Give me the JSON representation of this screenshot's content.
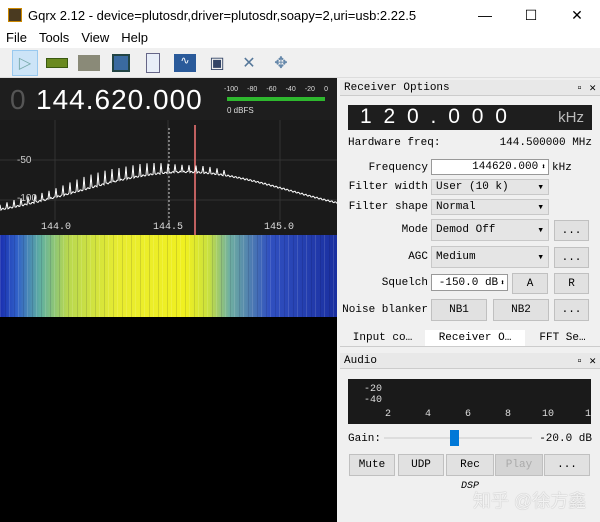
{
  "window": {
    "title": "Gqrx 2.12 - device=plutosdr,driver=plutosdr,soapy=2,uri=usb:2.22.5",
    "minimize": "—",
    "maximize": "☐",
    "close": "✕"
  },
  "menu": [
    "File",
    "Tools",
    "View",
    "Help"
  ],
  "toolbar": [
    "play-icon",
    "hardware-card-icon",
    "folder-icon",
    "save-icon",
    "document-icon",
    "waveform-icon",
    "network-icon",
    "tools-icon",
    "move-icon"
  ],
  "frequency_display": {
    "dim_digit": "0",
    "value": "144.620.000"
  },
  "signal_meter": {
    "scale": [
      "-100",
      "-80",
      "-60",
      "-40",
      "-20",
      "0"
    ],
    "label": "0 dBFS",
    "level_fraction": 1.0
  },
  "spectrum": {
    "y_labels": [
      "-50",
      "-100"
    ],
    "x_labels": [
      "144.0",
      "144.5",
      "145.0"
    ]
  },
  "receiver": {
    "title": "Receiver Options",
    "offset_display": "1 2 0 . 0 0 0",
    "offset_unit": "kHz",
    "hw_label": "Hardware freq:",
    "hw_value": "144.500000 MHz",
    "freq_label": "Frequency",
    "freq_value": "144620.000",
    "freq_unit": "kHz",
    "fw_label": "Filter width",
    "fw_value": "User (10 k)",
    "fs_label": "Filter shape",
    "fs_value": "Normal",
    "mode_label": "Mode",
    "mode_value": "Demod Off",
    "agc_label": "AGC",
    "agc_value": "Medium",
    "sq_label": "Squelch",
    "sq_value": "-150.0 dB",
    "sq_a": "A",
    "sq_r": "R",
    "nb_label": "Noise blanker",
    "nb1": "NB1",
    "nb2": "NB2",
    "more": "..."
  },
  "tabs": [
    "Input co…",
    "Receiver O…",
    "FFT Se…"
  ],
  "audio": {
    "title": "Audio",
    "y_labels": [
      "-20",
      "-40"
    ],
    "x_labels": [
      "2",
      "4",
      "6",
      "8",
      "10",
      "1"
    ],
    "gain_label": "Gain:",
    "gain_value": "-20.0 dB",
    "gain_fraction": 0.47,
    "buttons": [
      "Mute",
      "UDP",
      "Rec",
      "Play",
      "..."
    ],
    "dsp": "DSP"
  },
  "watermark": "知乎 @徐方鑫"
}
